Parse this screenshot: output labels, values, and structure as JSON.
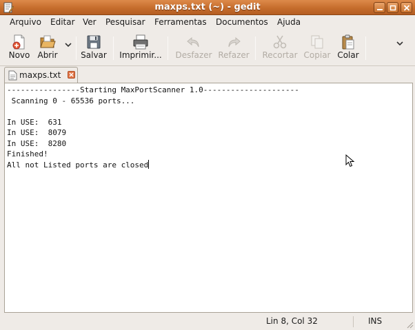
{
  "window": {
    "title": "maxps.txt (~) - gedit"
  },
  "menu": [
    "Arquivo",
    "Editar",
    "Ver",
    "Pesquisar",
    "Ferramentas",
    "Documentos",
    "Ajuda"
  ],
  "toolbar": {
    "new": "Novo",
    "open": "Abrir",
    "save": "Salvar",
    "print": "Imprimir...",
    "undo": "Desfazer",
    "redo": "Refazer",
    "cut": "Recortar",
    "copy": "Copiar",
    "paste": "Colar"
  },
  "tab": {
    "label": "maxps.txt"
  },
  "document": {
    "lines": [
      "----------------Starting MaxPortScanner 1.0---------------------",
      " Scanning 0 - 65536 ports...",
      "",
      "In USE:  631",
      "In USE:  8079",
      "In USE:  8280",
      "Finished!",
      "All not Listed ports are closed"
    ]
  },
  "status": {
    "position": "Lin 8, Col 32",
    "mode": "INS"
  },
  "colors": {
    "titlebar": "#c66d2c",
    "window_bg": "#efebe7",
    "editor_bg": "#ffffff"
  }
}
